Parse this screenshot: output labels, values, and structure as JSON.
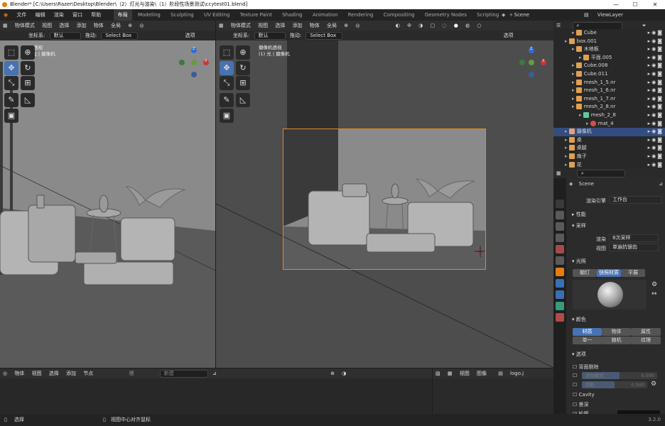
{
  "titlebar": {
    "title": "Blender* [C:\\Users\\Razer\\Desktop\\Blender\\（2）灯光与渲染\\（1）阶段性场景测试\\ccytest01.blend]",
    "minimize": "—",
    "maximize": "☐",
    "close": "✕"
  },
  "topbar": {
    "menus": [
      "文件",
      "编辑",
      "渲染",
      "窗口",
      "帮助"
    ],
    "workspaces": [
      "布局",
      "Modeling",
      "Sculpting",
      "UV Editing",
      "Texture Paint",
      "Shading",
      "Animation",
      "Rendering",
      "Compositing",
      "Geometry Nodes",
      "Scripting"
    ],
    "active_workspace": "布局",
    "add": "+",
    "scene": "Scene",
    "view_layer": "ViewLayer"
  },
  "viewport_left": {
    "mode": "物体模式",
    "menus": [
      "视图",
      "选择",
      "添加",
      "物体"
    ],
    "orientation": "全局",
    "coord_label": "坐标系:",
    "coord_value": "默认",
    "drag_label": "拖动:",
    "drag_value": "Select Box",
    "options": "选项",
    "overlay_line1": "用户透视",
    "overlay_line2": "(1) 光 | 摄像机"
  },
  "viewport_right": {
    "mode": "物体模式",
    "menus": [
      "视图",
      "选择",
      "添加",
      "物体"
    ],
    "orientation": "全局",
    "coord_label": "坐标系:",
    "coord_value": "默认",
    "drag_label": "拖动:",
    "drag_value": "Select Box",
    "options": "选项",
    "overlay_line1": "摄像机透视",
    "overlay_line2": "(1) 光 | 摄像机"
  },
  "gizmo": {
    "z": "Z",
    "x": "X"
  },
  "outliner": {
    "rows": [
      {
        "label": "Cube",
        "indent": 2,
        "icon": "tri"
      },
      {
        "label": "box.001",
        "indent": 1,
        "icon": "tri"
      },
      {
        "label": "木地板",
        "indent": 2,
        "icon": "tri"
      },
      {
        "label": "平面.005",
        "indent": 3,
        "icon": "tri"
      },
      {
        "label": "Cube.008",
        "indent": 2,
        "icon": "tri"
      },
      {
        "label": "Cube.011",
        "indent": 2,
        "icon": "tri"
      },
      {
        "label": "mesh_1_5.nr",
        "indent": 2,
        "icon": "tri"
      },
      {
        "label": "mesh_1_6.nr",
        "indent": 2,
        "icon": "tri"
      },
      {
        "label": "mesh_1_7.nr",
        "indent": 2,
        "icon": "tri"
      },
      {
        "label": "mesh_2_8.nr",
        "indent": 2,
        "icon": "tri"
      },
      {
        "label": "mesh_2_8",
        "indent": 3,
        "icon": "mesh"
      },
      {
        "label": "mat_4",
        "indent": 4,
        "icon": "mat"
      },
      {
        "label": "摄像机",
        "indent": 1,
        "icon": "cam"
      },
      {
        "label": "桌",
        "indent": 1,
        "icon": "tri"
      },
      {
        "label": "桌腿",
        "indent": 1,
        "icon": "tri"
      },
      {
        "label": "扇子",
        "indent": 1,
        "icon": "tri"
      },
      {
        "label": "花",
        "indent": 1,
        "icon": "tri"
      }
    ],
    "selected_row": "摄像机"
  },
  "properties": {
    "scene": "Scene",
    "render_engine_label": "渲染引擎",
    "render_engine": "工作台",
    "sections": {
      "performance": "性能",
      "sampling": "采样",
      "lighting": "光照",
      "color": "颜色",
      "options": "选项"
    },
    "render_label": "渲染",
    "render_value": "8次采样",
    "viewport_label": "视图",
    "viewport_value": "单遍抗锯齿",
    "lighting_buttons": [
      "棚灯",
      "快照材质",
      "平展"
    ],
    "lighting_active": "快照材质",
    "color_buttons": [
      "材质",
      "物体",
      "属性",
      "单一",
      "随机",
      "纹理"
    ],
    "color_active": "材质",
    "opt_backface": "背面剔除",
    "opt_xray": "透视模式",
    "opt_xray_val": "0.500",
    "opt_shadow": "阴影",
    "opt_shadow_val": "0.500",
    "opt_cavity": "Cavity",
    "opt_depth": "景深",
    "opt_outline": "轮廓"
  },
  "node_editor": {
    "mode": "物体",
    "menus": [
      "视图",
      "选择",
      "添加",
      "节点"
    ],
    "slot": "槽",
    "new": "新建"
  },
  "image_editor": {
    "menus": [
      "视图",
      "图像"
    ],
    "image": "logo.j"
  },
  "statusbar": {
    "select": "选择",
    "center": "视图中心对齐鼠标",
    "version": "3.2.0"
  },
  "colors": {
    "select_blue": "#4772b3",
    "camera_frame": "#e08a2c",
    "active_orange": "#e87d0d"
  }
}
